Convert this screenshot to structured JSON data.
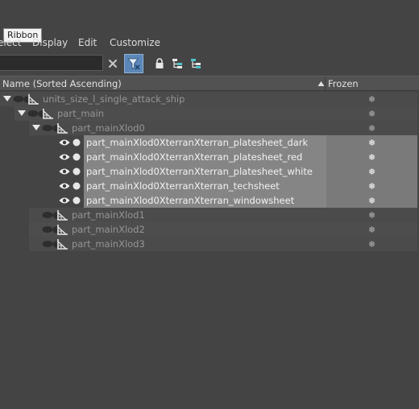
{
  "tooltip": "Ribbon",
  "menu": {
    "select": "elect",
    "display": "Display",
    "edit": "Edit",
    "customize": "Customize"
  },
  "header": {
    "name": "Name (Sorted Ascending)",
    "frozen": "Frozen"
  },
  "tree": [
    {
      "label": "units_size_l_single_attack_ship",
      "level": 0,
      "expanded": true,
      "dim": true
    },
    {
      "label": "part_main",
      "level": 1,
      "expanded": true,
      "dim": true
    },
    {
      "label": "part_mainXlod0",
      "level": 2,
      "expanded": true,
      "dim": true
    },
    {
      "label": "part_mainXlod0XterranXterran_platesheet_dark",
      "level": 3,
      "selected": true
    },
    {
      "label": "part_mainXlod0XterranXterran_platesheet_red",
      "level": 3,
      "selected": true
    },
    {
      "label": "part_mainXlod0XterranXterran_platesheet_white",
      "level": 3,
      "selected": true
    },
    {
      "label": "part_mainXlod0XterranXterran_techsheet",
      "level": 3,
      "selected": true
    },
    {
      "label": "part_mainXlod0XterranXterran_windowsheet",
      "level": 3,
      "selected": true
    },
    {
      "label": "part_mainXlod1",
      "level": 2,
      "dim": true
    },
    {
      "label": "part_mainXlod2",
      "level": 2,
      "dim": true
    },
    {
      "label": "part_mainXlod3",
      "level": 2,
      "dim": true
    }
  ],
  "colors": {
    "accent": "#5b87b8",
    "selected_row": "#858585",
    "dim_text": "#959595",
    "frozen_icon": "#cfcfcf"
  },
  "icons": {
    "clear": "close-icon",
    "filter": "filter-icon",
    "lock": "lock-icon",
    "hierarchy": "hierarchy-icon",
    "frozen": "snowflake-icon"
  }
}
